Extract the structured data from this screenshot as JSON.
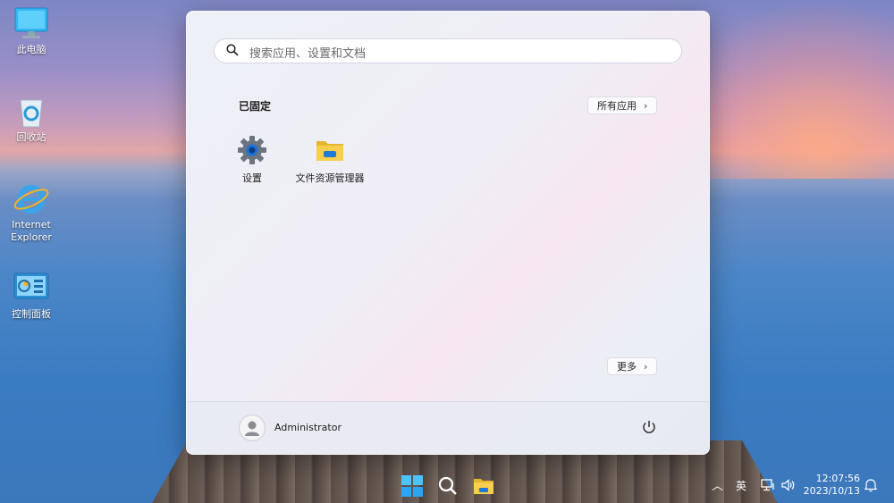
{
  "desktop": {
    "icons": [
      {
        "label": "此电脑",
        "icon": "computer-icon"
      },
      {
        "label": "回收站",
        "icon": "recycle-bin-icon"
      },
      {
        "label_line1": "Internet",
        "label_line2": "Explorer",
        "icon": "internet-explorer-icon"
      },
      {
        "label": "控制面板",
        "icon": "control-panel-icon"
      }
    ]
  },
  "start_menu": {
    "search": {
      "placeholder": "搜索应用、设置和文档",
      "icon": "search-icon"
    },
    "pinned": {
      "title": "已固定",
      "all_apps_label": "所有应用",
      "apps": [
        {
          "label": "设置",
          "icon": "settings-gear-icon"
        },
        {
          "label": "文件资源管理器",
          "icon": "folder-icon"
        }
      ]
    },
    "more_label": "更多",
    "user": {
      "name": "Administrator",
      "icon": "user-avatar-icon"
    },
    "power_icon": "power-icon"
  },
  "taskbar": {
    "items": [
      "start-icon",
      "search-icon",
      "file-explorer-icon"
    ],
    "tray": {
      "chevron_icon": "chevron-up-icon",
      "ime_label": "英",
      "network_icon": "network-icon",
      "volume_icon": "volume-icon",
      "notification_icon": "notification-icon"
    },
    "clock": {
      "time": "12:07:56",
      "date": "2023/10/13"
    }
  },
  "colors": {
    "accent": "#1a73d9",
    "folder": "#f5c842"
  }
}
